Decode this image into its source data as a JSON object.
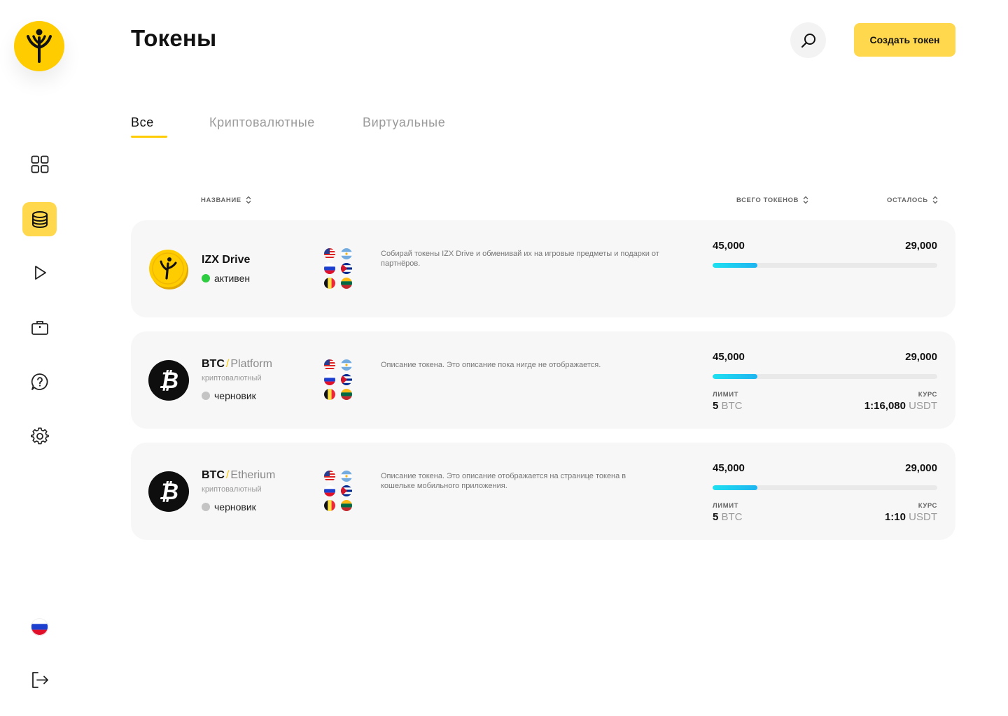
{
  "header": {
    "title": "Токены",
    "create_button": "Создать токен"
  },
  "tabs": [
    {
      "label": "Все",
      "active": true
    },
    {
      "label": "Криптовалютные",
      "active": false
    },
    {
      "label": "Виртуальные",
      "active": false
    }
  ],
  "columns": {
    "name": "НАЗВАНИЕ",
    "total": "ВСЕГО ТОКЕНОВ",
    "remaining": "ОСТАЛОСЬ"
  },
  "sidebar": {
    "items": [
      {
        "icon": "dashboard-grid-icon",
        "active": false
      },
      {
        "icon": "database-coins-icon",
        "active": true
      },
      {
        "icon": "play-icon",
        "active": false
      },
      {
        "icon": "briefcase-icon",
        "active": false
      },
      {
        "icon": "help-chat-icon",
        "active": false
      },
      {
        "icon": "settings-gear-icon",
        "active": false
      }
    ],
    "language_flag": "russia-flag-icon",
    "logout_icon": "logout-icon"
  },
  "tokens": [
    {
      "name": "IZX Drive",
      "network": "",
      "type": "",
      "status": "активен",
      "status_color": "#2ECC40",
      "description": "Собирай токены IZX Drive и обменивай их на игровые предметы и подарки от партнёров.",
      "total": "45,000",
      "remaining": "29,000",
      "progress": 0.2,
      "limit_label": "",
      "limit_value": "",
      "limit_unit": "",
      "rate_label": "",
      "rate_value": "",
      "rate_unit": ""
    },
    {
      "name": "BTC",
      "network": "Platform",
      "type": "криптовалютный",
      "status": "черновик",
      "status_color": "#C4C4C4",
      "description": "Описание токена. Это описание пока нигде не отображается.",
      "total": "45,000",
      "remaining": "29,000",
      "progress": 0.2,
      "limit_label": "ЛИМИТ",
      "limit_value": "5",
      "limit_unit": "BTC",
      "rate_label": "КУРС",
      "rate_value": "1:16,080",
      "rate_unit": "USDT"
    },
    {
      "name": "BTC",
      "network": "Etherium",
      "type": "криптовалютный",
      "status": "черновик",
      "status_color": "#C4C4C4",
      "description": "Описание токена. Это описание отображается на странице токена в кошельке мобильного приложения.",
      "total": "45,000",
      "remaining": "29,000",
      "progress": 0.2,
      "limit_label": "ЛИМИТ",
      "limit_value": "5",
      "limit_unit": "BTC",
      "rate_label": "КУРС",
      "rate_value": "1:10",
      "rate_unit": "USDT"
    }
  ],
  "flags": [
    "usa-flag-icon",
    "argentina-flag-icon",
    "russia-flag-icon",
    "cuba-flag-icon",
    "belgium-flag-icon",
    "lithuania-flag-icon"
  ],
  "colors": {
    "accent": "#FFD84D",
    "brand_yellow": "#FFCC00",
    "progress": "#1EE0F0",
    "card_bg": "#F7F7F7"
  }
}
